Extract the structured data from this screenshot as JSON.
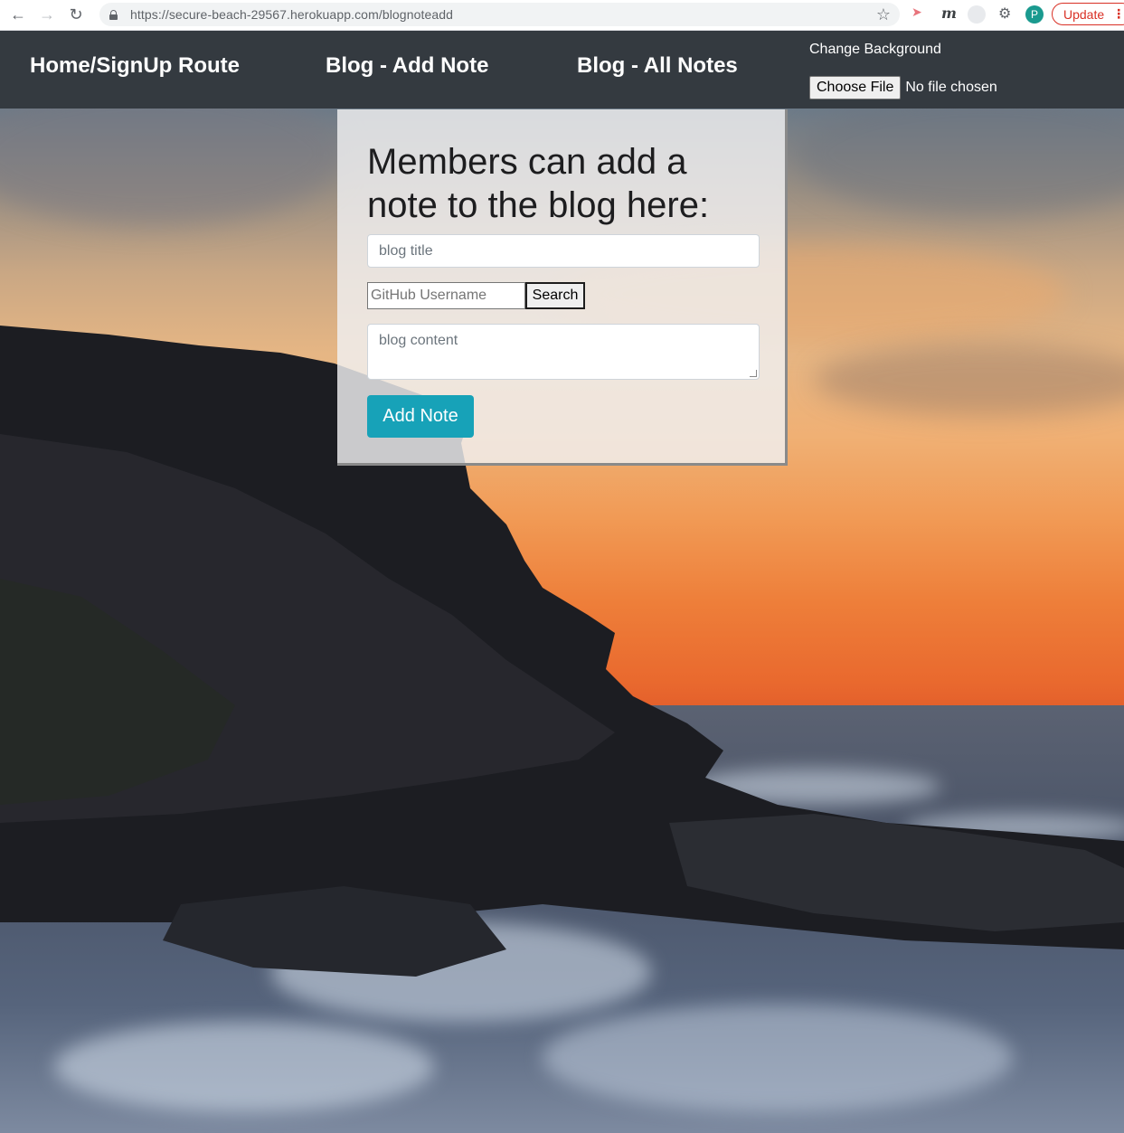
{
  "browser": {
    "url": "https://secure-beach-29567.herokuapp.com/blognoteadd",
    "avatar_letter": "P",
    "update_label": "Update",
    "icons": [
      "back-arrow-icon",
      "forward-arrow-icon",
      "reload-icon",
      "lock-icon",
      "star-icon",
      "extension-icon",
      "puzzle-icon",
      "menu-dots-icon"
    ]
  },
  "navbar": {
    "links": [
      "Home/SignUp Route",
      "Blog - Add Note",
      "Blog - All Notes"
    ],
    "background_label": "Change Background",
    "choose_file_label": "Choose File",
    "no_file_text": "No file chosen",
    "background_color": "#343a40"
  },
  "form": {
    "heading": "Members can add a note to the blog here:",
    "title_placeholder": "blog title",
    "github_placeholder": "GitHub Username",
    "search_label": "Search",
    "content_placeholder": "blog content",
    "submit_label": "Add Note",
    "submit_color": "#17a2b8"
  }
}
